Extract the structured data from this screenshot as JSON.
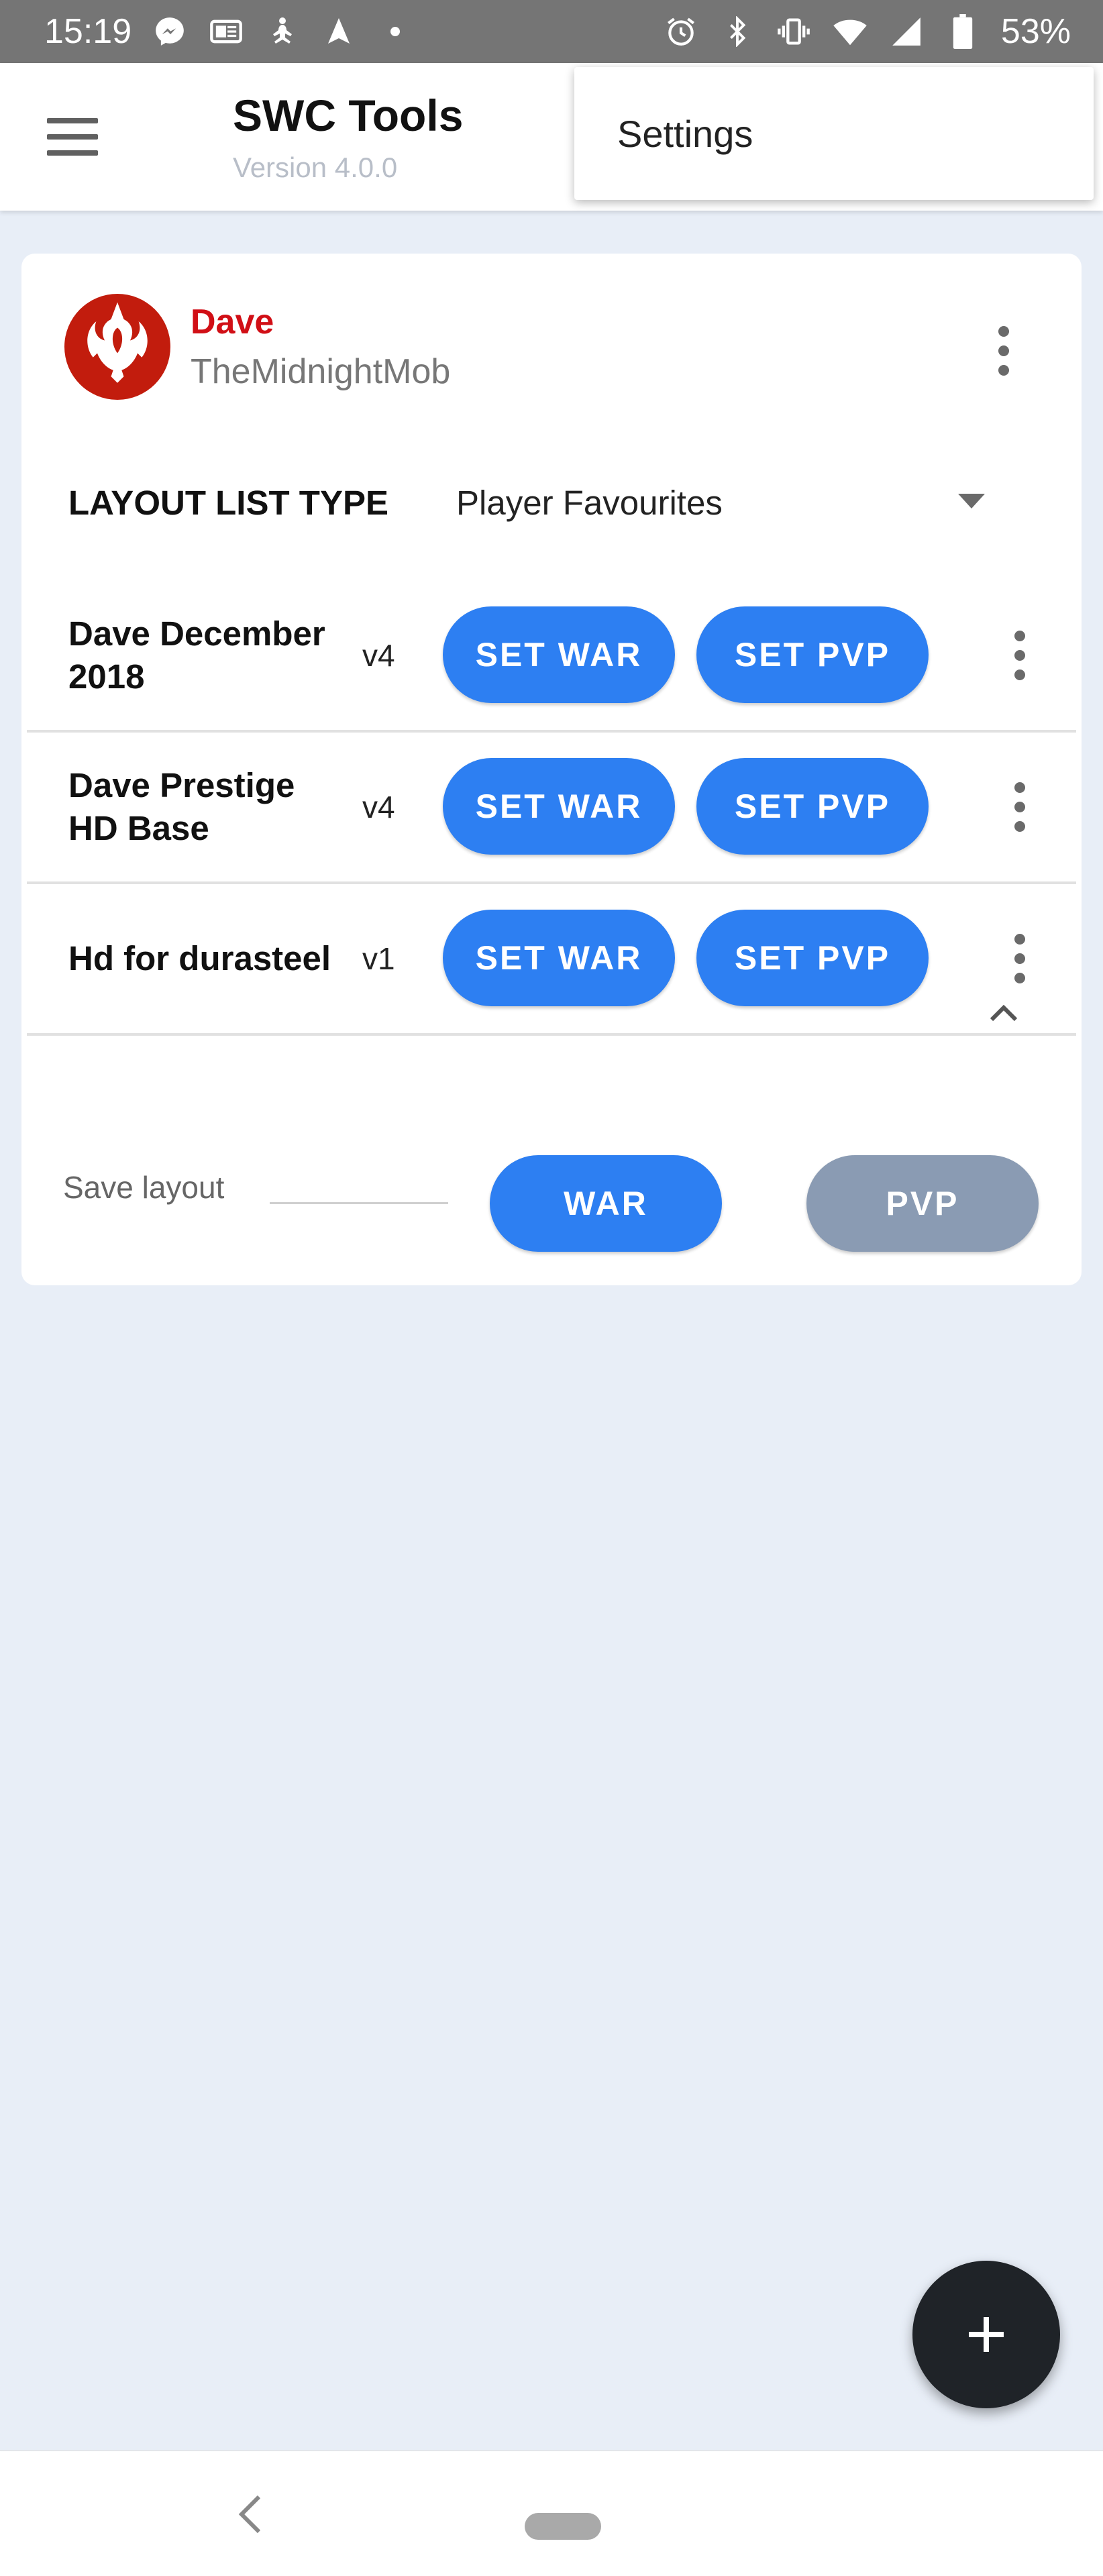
{
  "status_bar": {
    "time": "15:19",
    "battery": "53%",
    "left_icons": [
      "messenger-icon",
      "outlook-icon",
      "yoga-icon",
      "navigation-icon",
      "dot-icon"
    ],
    "right_icons": [
      "alarm-icon",
      "bluetooth-icon",
      "vibrate-icon",
      "wifi-icon",
      "signal-icon",
      "battery-icon"
    ]
  },
  "app_bar": {
    "title": "SWC Tools",
    "version": "Version 4.0.0"
  },
  "popup_menu": {
    "items": [
      "Settings"
    ]
  },
  "profile": {
    "name": "Dave",
    "guild": "TheMidnightMob",
    "name_color": "#d10f16",
    "avatar_icon": "rebel-alliance-icon"
  },
  "layout_list_type": {
    "label": "LAYOUT LIST TYPE",
    "selected": "Player Favourites"
  },
  "layouts": [
    {
      "name": "Dave December 2018",
      "version": "v4",
      "war_label": "SET WAR",
      "pvp_label": "SET PVP"
    },
    {
      "name": "Dave Prestige HD Base",
      "version": "v4",
      "war_label": "SET WAR",
      "pvp_label": "SET PVP"
    },
    {
      "name": "Hd for durasteel",
      "version": "v1",
      "war_label": "SET WAR",
      "pvp_label": "SET PVP"
    }
  ],
  "save_layout": {
    "label": "Save layout",
    "war_label": "WAR",
    "pvp_label": "PVP"
  },
  "colors": {
    "accent": "#2d7ff2",
    "disabled": "#8a9bb3",
    "background": "#e8eef7",
    "fab": "#1f2328"
  }
}
